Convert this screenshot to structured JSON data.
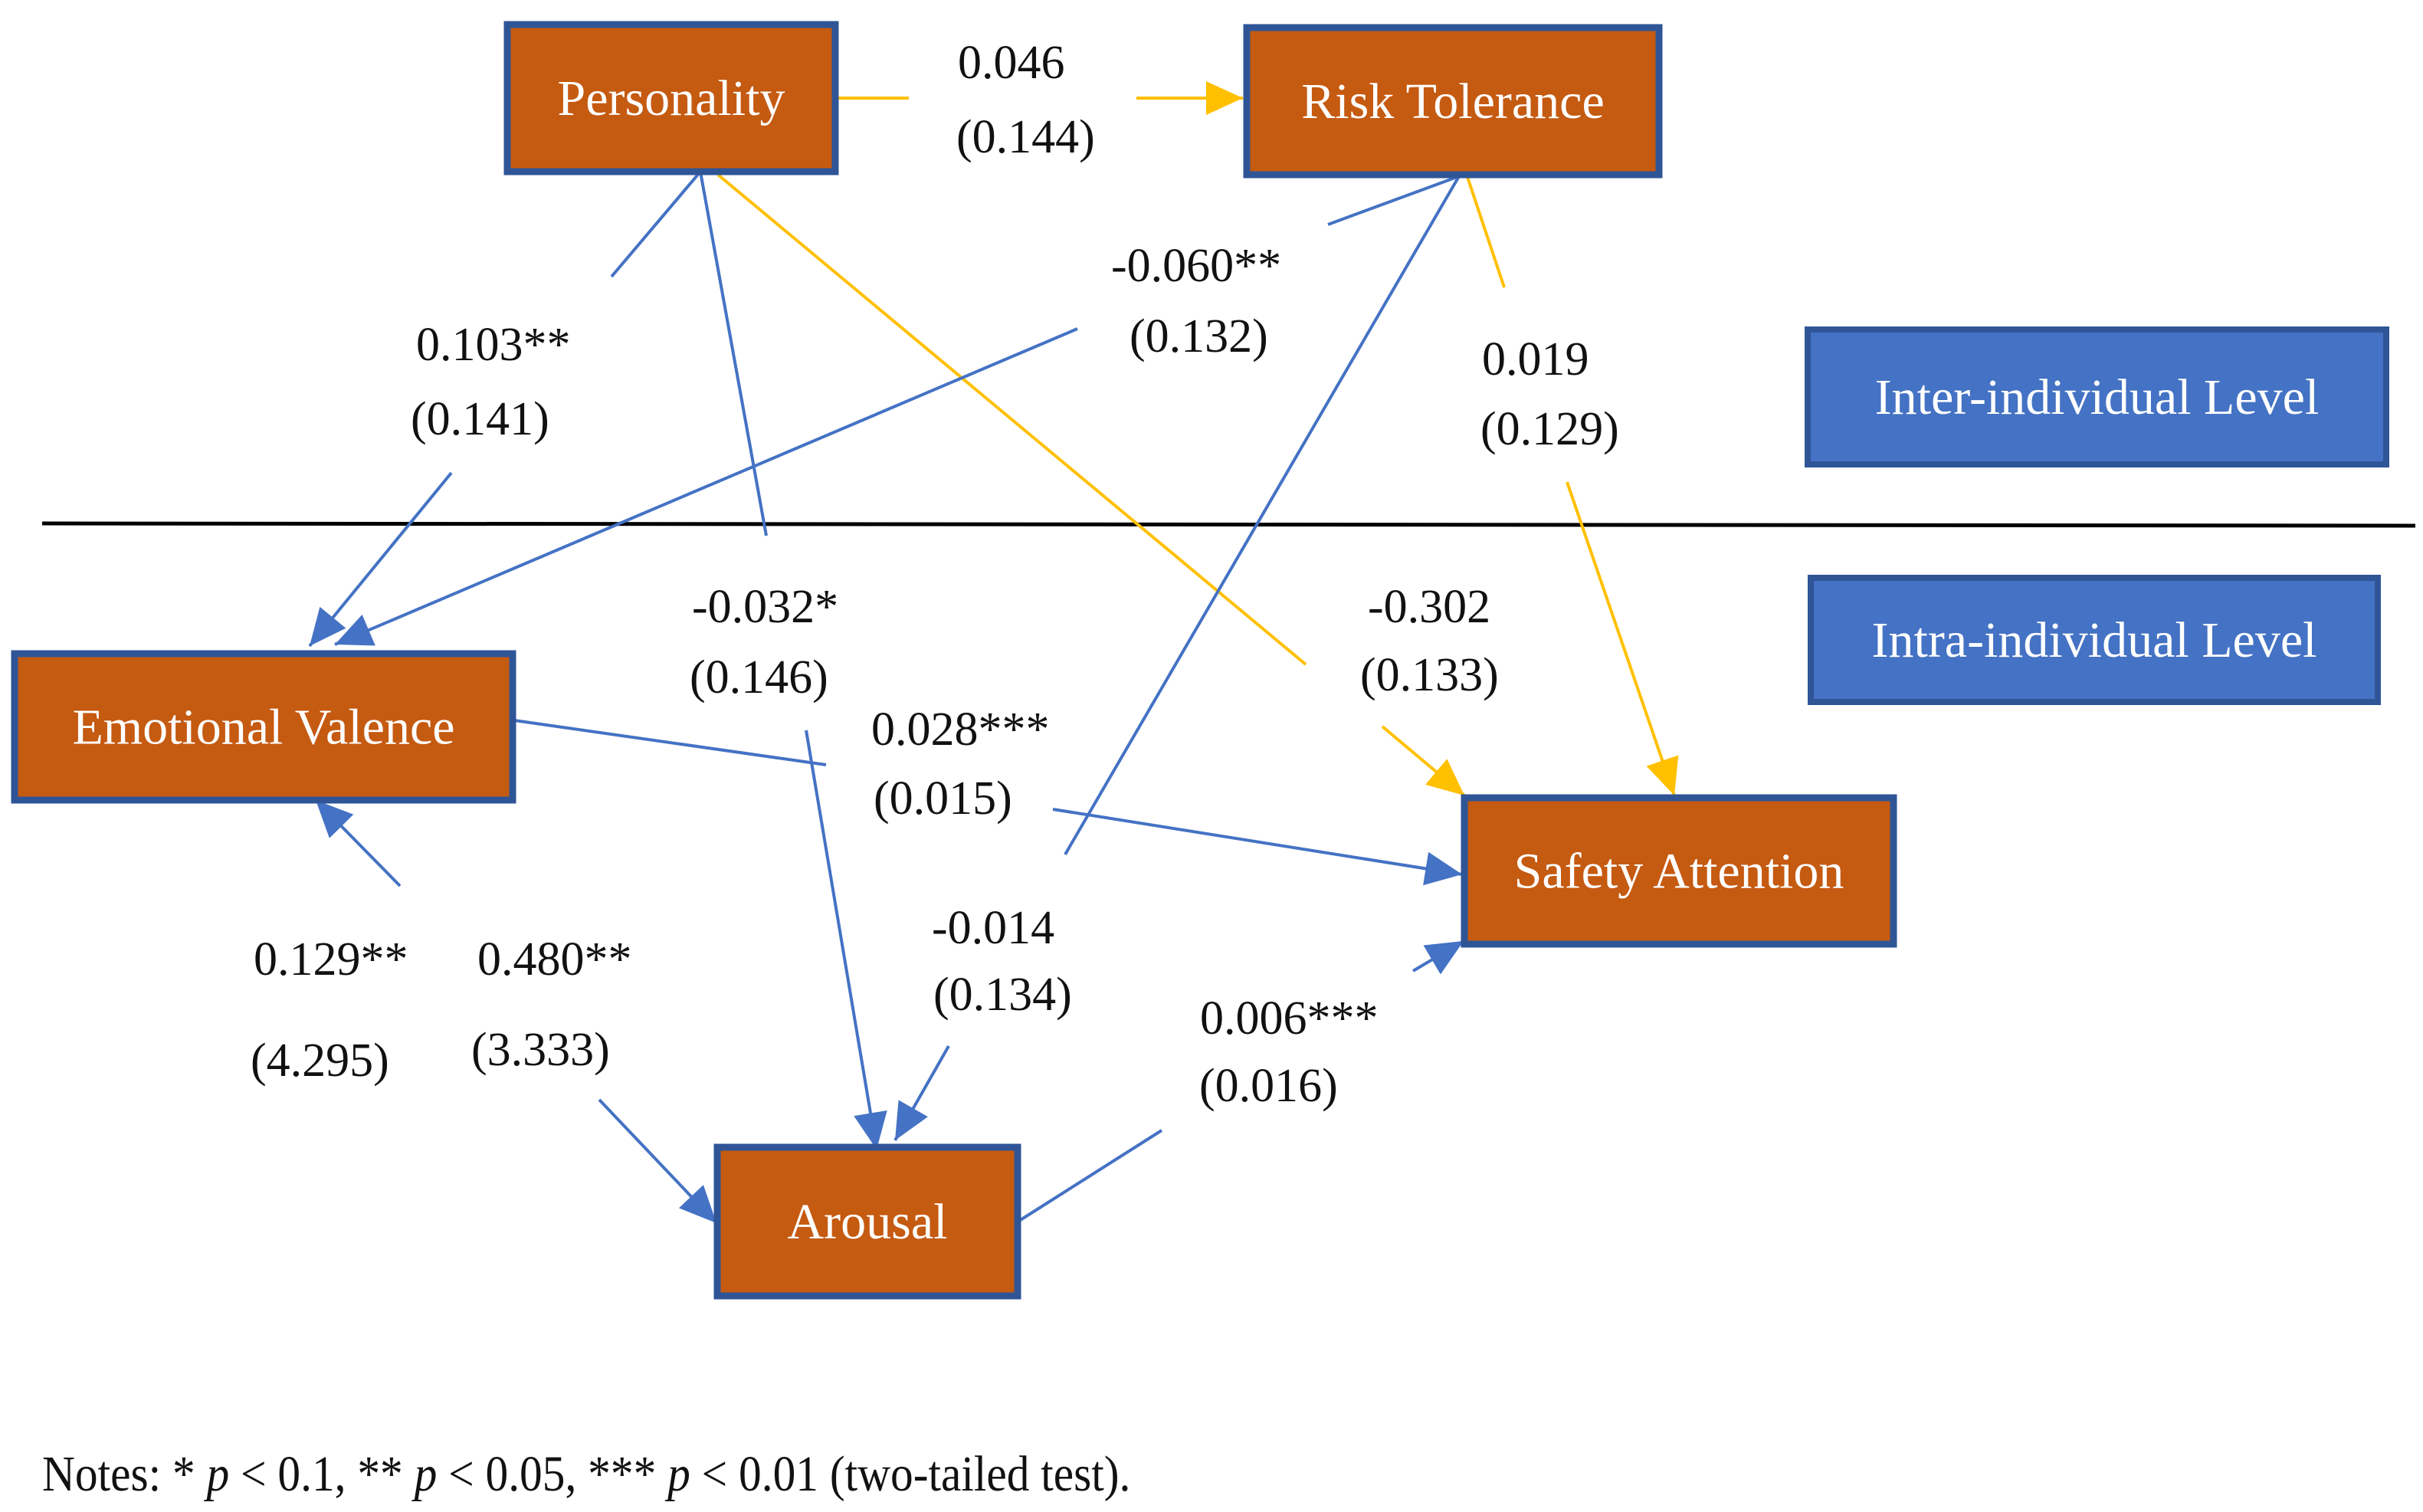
{
  "colors": {
    "node_fill": "#C55A11",
    "node_border": "#2F5597",
    "level_fill": "#4472C4",
    "level_border": "#2F5597",
    "path_blue": "#4472C4",
    "path_yellow": "#FFC000",
    "divider": "#000000",
    "text": "#111111"
  },
  "nodes": [
    {
      "id": "personality",
      "label": "Personality",
      "level": "inter"
    },
    {
      "id": "risk_tolerance",
      "label": "Risk Tolerance",
      "level": "inter"
    },
    {
      "id": "emotional_valence",
      "label": "Emotional Valence",
      "level": "intra"
    },
    {
      "id": "safety_attention",
      "label": "Safety Attention",
      "level": "intra"
    },
    {
      "id": "arousal",
      "label": "Arousal",
      "level": "intra"
    }
  ],
  "levels": {
    "inter": "Inter-individual Level",
    "intra": "Intra-individual Level"
  },
  "edges": [
    {
      "id": "pers_risk",
      "from": "personality",
      "to": "risk_tolerance",
      "coef": "0.046",
      "se": "(0.144)",
      "color": "yellow"
    },
    {
      "id": "pers_ev",
      "from": "personality",
      "to": "emotional_valence",
      "coef": "0.103**",
      "se": "(0.141)",
      "color": "blue"
    },
    {
      "id": "pers_arousal",
      "from": "personality",
      "to": "arousal",
      "coef": "-0.032*",
      "se": "(0.146)",
      "color": "blue"
    },
    {
      "id": "pers_sa",
      "from": "personality",
      "to": "safety_attention",
      "coef": "-0.302",
      "se": "(0.133)",
      "color": "yellow"
    },
    {
      "id": "risk_ev",
      "from": "risk_tolerance",
      "to": "emotional_valence",
      "coef": "-0.060**",
      "se": "(0.132)",
      "color": "blue"
    },
    {
      "id": "risk_arousal",
      "from": "risk_tolerance",
      "to": "arousal",
      "coef": "-0.014",
      "se": "(0.134)",
      "color": "blue"
    },
    {
      "id": "risk_sa",
      "from": "risk_tolerance",
      "to": "safety_attention",
      "coef": "0.019",
      "se": "(0.129)",
      "color": "yellow"
    },
    {
      "id": "ev_sa",
      "from": "emotional_valence",
      "to": "safety_attention",
      "coef": "0.028***",
      "se": "(0.015)",
      "color": "blue"
    },
    {
      "id": "arousal_sa",
      "from": "arousal",
      "to": "safety_attention",
      "coef": "0.006***",
      "se": "(0.016)",
      "color": "blue"
    },
    {
      "id": "arousal_ev",
      "from": "arousal",
      "to": "emotional_valence",
      "coef": "0.129**",
      "se": "(4.295)",
      "color": "blue"
    },
    {
      "id": "ev_arousal",
      "from": "emotional_valence",
      "to": "arousal",
      "coef": "0.480**",
      "se": "(3.333)",
      "color": "blue"
    }
  ],
  "notes": {
    "prefix": "Notes: ",
    "items": [
      {
        "stars": "*",
        "p": "p",
        "threshold": " < 0.1, "
      },
      {
        "stars": "**",
        "p": "p",
        "threshold": " < 0.05, "
      },
      {
        "stars": "***",
        "p": "p",
        "threshold": " < 0.01 (two-tailed test)."
      }
    ]
  }
}
